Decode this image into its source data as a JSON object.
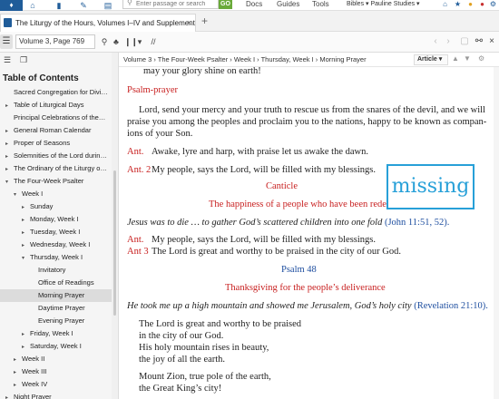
{
  "appbar": {
    "logo": "♦",
    "search_placeholder": "Enter passage or search",
    "go_label": "GO",
    "menus": [
      "Docs",
      "Guides",
      "Tools"
    ],
    "library_label": "Bibles ▾  Pauline Studies ▾"
  },
  "tab": {
    "title": "The Liturgy of the Hours, Volumes I–IV and Supplement",
    "close": "×",
    "add": "+"
  },
  "toolbar": {
    "reference": "Volume 3, Page 769"
  },
  "breadcrumb": {
    "text": "Volume 3  ›  The Four-Week Psalter  ›  Week I  ›  Thursday, Week I  ›  Morning Prayer",
    "view_mode": "Article ▾"
  },
  "sidebar": {
    "title": "Table of Contents",
    "items": [
      {
        "label": "Sacred Congregation for Divi…",
        "arrow": "",
        "indent": 0
      },
      {
        "label": "Table of Liturgical Days",
        "arrow": "▸",
        "indent": 0
      },
      {
        "label": "Principal Celebrations of the…",
        "arrow": "",
        "indent": 0
      },
      {
        "label": "General Roman Calendar",
        "arrow": "▸",
        "indent": 0
      },
      {
        "label": "Proper of Seasons",
        "arrow": "▸",
        "indent": 0
      },
      {
        "label": "Solemnities of the Lord durin…",
        "arrow": "▸",
        "indent": 0
      },
      {
        "label": "The Ordinary of the Liturgy o…",
        "arrow": "▸",
        "indent": 0
      },
      {
        "label": "The Four-Week Psalter",
        "arrow": "▾",
        "indent": 0
      },
      {
        "label": "Week I",
        "arrow": "▾",
        "indent": 1
      },
      {
        "label": "Sunday",
        "arrow": "▸",
        "indent": 2
      },
      {
        "label": "Monday, Week I",
        "arrow": "▸",
        "indent": 2
      },
      {
        "label": "Tuesday, Week I",
        "arrow": "▸",
        "indent": 2
      },
      {
        "label": "Wednesday, Week I",
        "arrow": "▸",
        "indent": 2
      },
      {
        "label": "Thursday, Week I",
        "arrow": "▾",
        "indent": 2
      },
      {
        "label": "Invitatory",
        "arrow": "",
        "indent": 3
      },
      {
        "label": "Office of Readings",
        "arrow": "",
        "indent": 3
      },
      {
        "label": "Morning Prayer",
        "arrow": "",
        "indent": 3,
        "selected": true
      },
      {
        "label": "Daytime Prayer",
        "arrow": "",
        "indent": 3
      },
      {
        "label": "Evening Prayer",
        "arrow": "",
        "indent": 3
      },
      {
        "label": "Friday, Week I",
        "arrow": "▸",
        "indent": 2
      },
      {
        "label": "Saturday, Week I",
        "arrow": "▸",
        "indent": 2
      },
      {
        "label": "Week II",
        "arrow": "▸",
        "indent": 1
      },
      {
        "label": "Week III",
        "arrow": "▸",
        "indent": 1
      },
      {
        "label": "Week IV",
        "arrow": "▸",
        "indent": 1
      },
      {
        "label": "Night Prayer",
        "arrow": "▸",
        "indent": 0
      }
    ]
  },
  "reader": {
    "top_line": "may your glory shine on earth!",
    "psalm_prayer_heading": "Psalm-prayer",
    "prayer_lines": [
      "Lord, send your mercy and your truth to rescue us from the snares of the devil, and we will",
      "praise you among the peoples and proclaim you to the nations, happy to be known as compan-",
      "ions of your Son."
    ],
    "ant1_label": "Ant.",
    "ant1_text": "Awake, lyre and harp, with praise let us awake the dawn.",
    "ant2_label": "Ant. 2",
    "ant2_text": "My people, says the Lord, will be filled with my blessings.",
    "canticle_heading": "Canticle",
    "canticle_subtitle": "The happiness of a people who have been redeemed",
    "canticle_quote": "Jesus was to die … to gather God’s scattered children into one fold",
    "canticle_ref": "(John 11:51, 52).",
    "ant_label": "Ant.",
    "ant_repeat_text": "My people, says the Lord, will be filled with my blessings.",
    "ant3_label": "Ant 3",
    "ant3_text": "The Lord is great and worthy to be praised in the city of our God.",
    "psalm_heading": "Psalm 48",
    "psalm_subtitle": "Thanksgiving for the people’s deliverance",
    "psalm_quote": "He took me up a high mountain and showed me Jerusalem, God’s holy city",
    "psalm_ref": "(Revelation 21:10).",
    "verse_lines": [
      "The Lord is great and worthy to be praised",
      "in the city of our God.",
      "His holy mountain rises in beauty,",
      "the joy of all the earth."
    ],
    "verse2_lines": [
      "Mount Zion, true pole of the earth,",
      "the Great King’s city!"
    ]
  },
  "missing_image": {
    "text": "missing"
  },
  "colors": {
    "rubric_red": "#c82020",
    "link_blue": "#1f4fa0",
    "brand_blue": "#1f5c99",
    "go_green": "#6aaa3a",
    "missing_blue": "#27a0d8"
  }
}
